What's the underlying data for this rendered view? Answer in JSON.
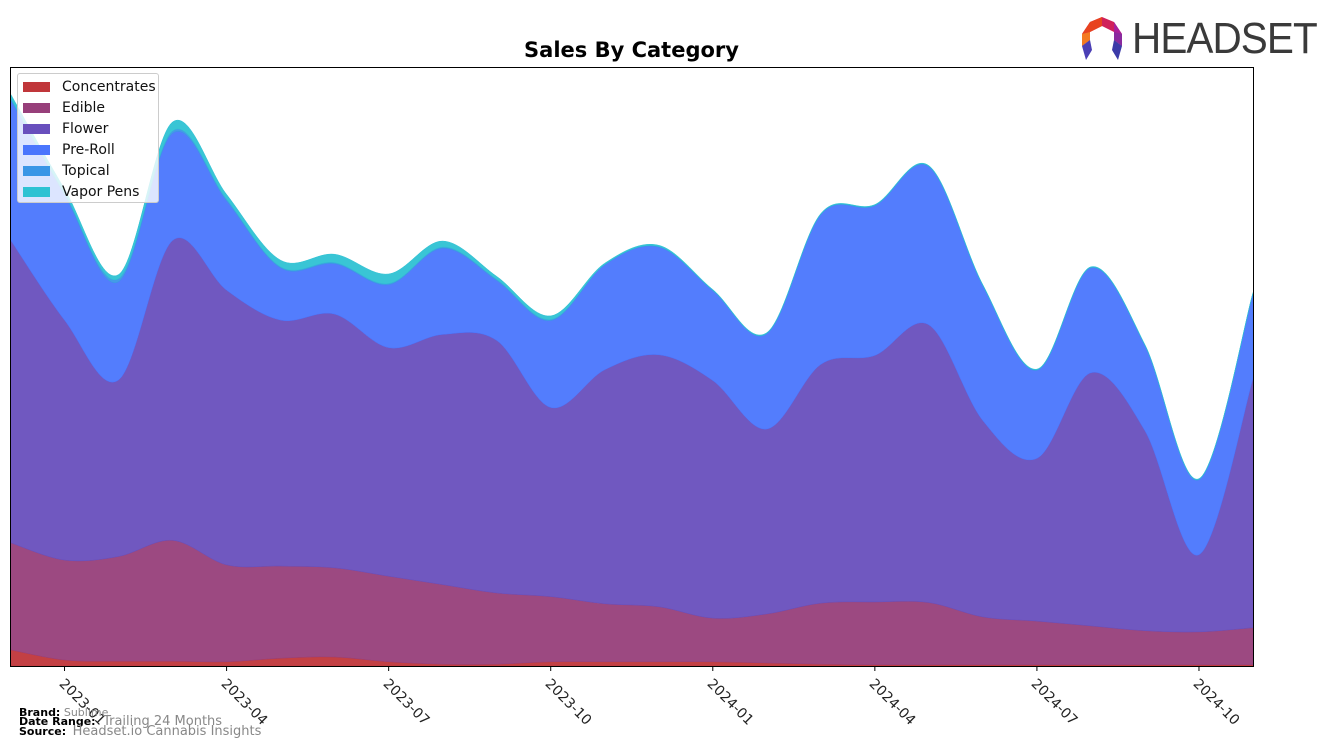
{
  "header": {
    "logo_text": "HEADSET"
  },
  "footer": {
    "brand_label": "Brand:",
    "brand_value": "Sublime",
    "date_range_label": "Date Range:",
    "date_range_value": "Trailing 24 Months",
    "source_label": "Source:",
    "source_value": "Headset.io Cannabis Insights"
  },
  "chart_data": {
    "type": "area",
    "stacked": true,
    "smoothed": true,
    "title": "Sales By Category",
    "xlabel": "",
    "ylabel": "",
    "y_unit": "relative sales index (no y-axis shown; 100 = top of plot)",
    "ylim": [
      0,
      100
    ],
    "legend_position": "top-left",
    "grid": false,
    "x": [
      "2022-12",
      "2023-01",
      "2023-02",
      "2023-03",
      "2023-04",
      "2023-05",
      "2023-06",
      "2023-07",
      "2023-08",
      "2023-09",
      "2023-10",
      "2023-11",
      "2023-12",
      "2024-01",
      "2024-02",
      "2024-03",
      "2024-04",
      "2024-05",
      "2024-06",
      "2024-07",
      "2024-08",
      "2024-09",
      "2024-10",
      "2024-11"
    ],
    "x_tick_labels": [
      "2023-01",
      "2023-04",
      "2023-07",
      "2023-10",
      "2024-01",
      "2024-04",
      "2024-07",
      "2024-10"
    ],
    "series": [
      {
        "name": "Concentrates",
        "color": "#c0363a",
        "values": [
          2.7,
          1.0,
          0.8,
          0.8,
          0.7,
          1.3,
          1.5,
          0.7,
          0.3,
          0.3,
          0.7,
          0.7,
          0.7,
          0.7,
          0.5,
          0.3,
          0.2,
          0.2,
          0.2,
          0.2,
          0.2,
          0.2,
          0.2,
          0.2
        ]
      },
      {
        "name": "Edible",
        "color": "#973f7a",
        "values": [
          17.9,
          16.7,
          17.5,
          20.2,
          16.2,
          15.4,
          14.9,
          14.3,
          13.3,
          11.9,
          10.9,
          9.7,
          9.2,
          7.3,
          8.2,
          10.2,
          10.5,
          10.4,
          8.0,
          7.3,
          6.5,
          5.7,
          5.5,
          6.2
        ]
      },
      {
        "name": "Flower",
        "color": "#684fbd",
        "values": [
          50.6,
          40.1,
          29.5,
          50.1,
          45.9,
          41.1,
          42.4,
          38.2,
          41.8,
          42.2,
          31.6,
          39.1,
          42.1,
          39.7,
          30.9,
          39.9,
          41.2,
          46.4,
          32.8,
          27.2,
          42.3,
          33.4,
          12.9,
          41.6
        ]
      },
      {
        "name": "Pre-Roll",
        "color": "#4a76fd",
        "values": [
          23.4,
          20.9,
          16.4,
          17.9,
          14.9,
          8.7,
          8.4,
          10.5,
          14.4,
          10.0,
          14.5,
          17.5,
          18.0,
          15.0,
          15.9,
          25.0,
          25.0,
          26.4,
          22.5,
          14.7,
          17.5,
          14.2,
          12.5,
          14.2
        ]
      },
      {
        "name": "Topical",
        "color": "#3a96e6",
        "values": [
          0.3,
          0.3,
          0.5,
          0.4,
          0.3,
          0.2,
          0.2,
          0.2,
          0.2,
          0.2,
          0.2,
          0.1,
          0.1,
          0.1,
          0.1,
          0.1,
          0.1,
          0.1,
          0.1,
          0.1,
          0.1,
          0.1,
          0.1,
          0.1
        ]
      },
      {
        "name": "Vapor Pens",
        "color": "#2ec2d3",
        "values": [
          0.7,
          0.7,
          0.7,
          1.5,
          0.8,
          1.1,
          1.4,
          1.6,
          1.0,
          0.5,
          0.6,
          0.2,
          0.2,
          0.1,
          0.1,
          0.1,
          0.1,
          0.1,
          0.1,
          0.1,
          0.1,
          0.1,
          0.1,
          0.1
        ]
      }
    ]
  }
}
